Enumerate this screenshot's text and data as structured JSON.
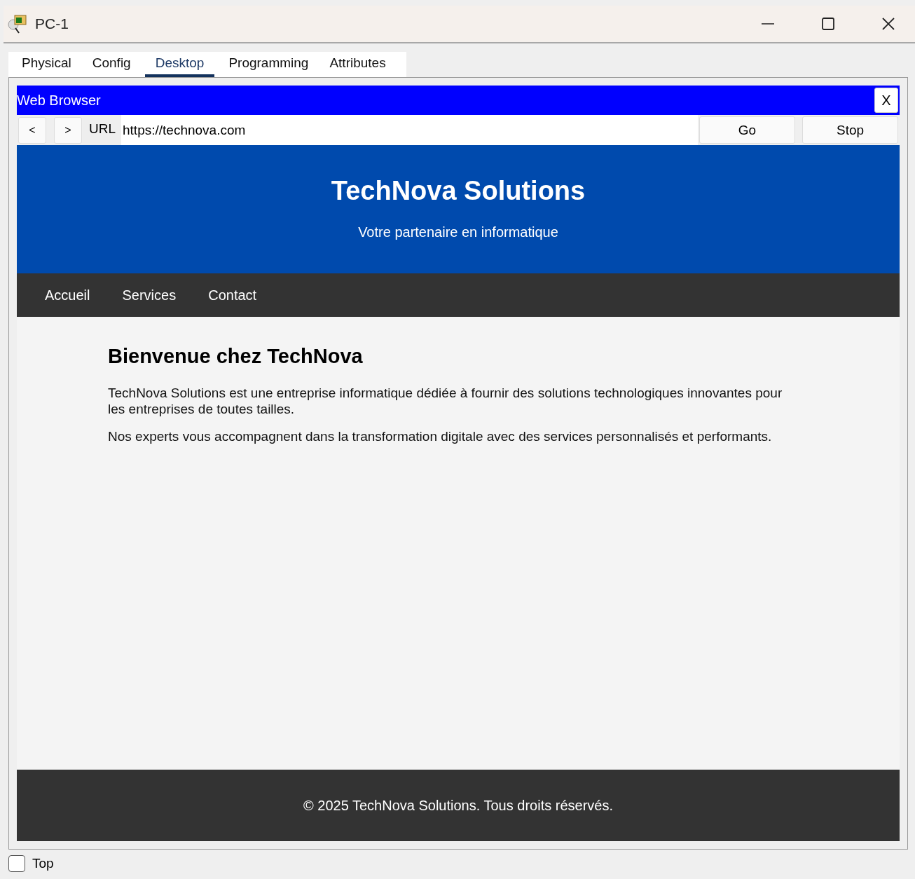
{
  "window": {
    "title": "PC-1"
  },
  "tabs": [
    {
      "label": "Physical",
      "selected": false
    },
    {
      "label": "Config",
      "selected": false
    },
    {
      "label": "Desktop",
      "selected": true
    },
    {
      "label": "Programming",
      "selected": false
    },
    {
      "label": "Attributes",
      "selected": false
    }
  ],
  "browser": {
    "title": "Web Browser",
    "close": "X",
    "back": "<",
    "forward": ">",
    "url_label": "URL",
    "url": "https://technova.com",
    "go": "Go",
    "stop": "Stop"
  },
  "site": {
    "heading": "TechNova Solutions",
    "tagline": "Votre partenaire en informatique",
    "nav": [
      "Accueil",
      "Services",
      "Contact"
    ],
    "title": "Bienvenue chez TechNova",
    "paragraphs": [
      "TechNova Solutions est une entreprise informatique dédiée à fournir des solutions technologiques innovantes pour les entreprises de toutes tailles.",
      "Nos experts vous accompagnent dans la transformation digitale avec des services personnalisés et performants."
    ],
    "footer": "© 2025 TechNova Solutions. Tous droits réservés."
  },
  "top_checkbox": {
    "label": "Top",
    "checked": false
  }
}
